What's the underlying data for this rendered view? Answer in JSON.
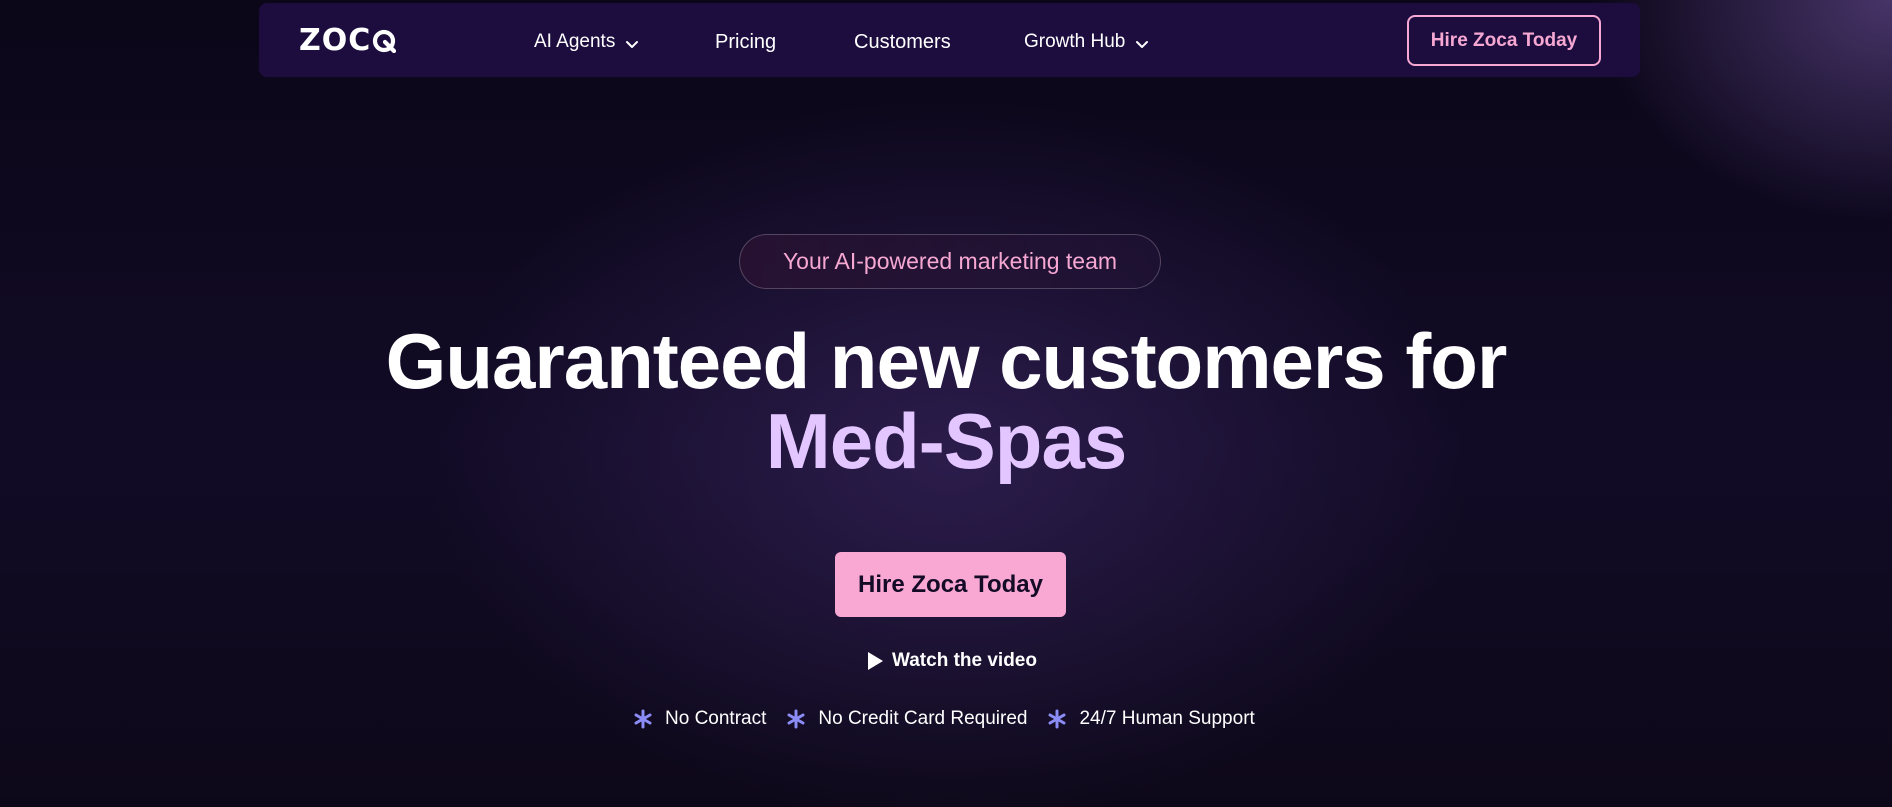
{
  "brand": {
    "logo_text": "ZOC",
    "logo_q": "Q"
  },
  "nav": {
    "items": [
      {
        "label": "AI Agents",
        "has_dropdown": true
      },
      {
        "label": "Pricing",
        "has_dropdown": false
      },
      {
        "label": "Customers",
        "has_dropdown": false
      },
      {
        "label": "Growth Hub",
        "has_dropdown": true
      }
    ],
    "cta_label": "Hire Zoca Today"
  },
  "hero": {
    "tagline": "Your AI-powered marketing team",
    "headline_line1": "Guaranteed new customers for",
    "headline_line2": "Med-Spas",
    "cta_label": "Hire Zoca Today",
    "watch_label": "Watch the video",
    "features": [
      "No Contract",
      "No Credit Card Required",
      "24/7 Human Support"
    ]
  },
  "icons": {
    "dropdown": "chevron-down-icon",
    "play": "play-icon",
    "feature": "asterisk-icon"
  },
  "colors": {
    "background": "#0c0719",
    "nav_bg": "#1d0d3f",
    "accent_pink": "#f9a8d4",
    "headline_highlight": "#e3c6ff",
    "feature_icon": "#8b8cf5"
  }
}
